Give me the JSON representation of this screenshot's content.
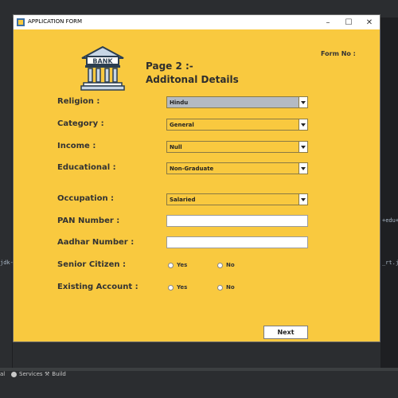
{
  "window": {
    "title": "APPLICATION FORM",
    "minimize_glyph": "–",
    "maximize_glyph": "☐",
    "close_glyph": "✕"
  },
  "header": {
    "bank_sign": "BANK",
    "page_title": "Page 2 :-",
    "page_subtitle": "Additonal Details",
    "form_no_label": "Form No :"
  },
  "fields": {
    "religion": {
      "label": "Religion :",
      "value": "Hindu"
    },
    "category": {
      "label": "Category :",
      "value": "General"
    },
    "income": {
      "label": "Income :",
      "value": "Null"
    },
    "educational": {
      "label": "Educational :",
      "value": "Non-Graduate"
    },
    "occupation": {
      "label": "Occupation :",
      "value": "Salaried"
    },
    "pan": {
      "label": "PAN Number :",
      "value": ""
    },
    "aadhar": {
      "label": "Aadhar Number :",
      "value": ""
    },
    "senior_citizen": {
      "label": "Senior Citizen :",
      "yes": "Yes",
      "no": "No"
    },
    "existing_account": {
      "label": "Existing Account :",
      "yes": "Yes",
      "no": "No"
    }
  },
  "buttons": {
    "next": "Next"
  },
  "ide": {
    "status_services": "Services",
    "status_build": "Build",
    "status_left": "al",
    "right_snippet_1": "+edu+",
    "right_snippet_2": "_rt.j",
    "left_snippet": "jdk-"
  },
  "colors": {
    "form_background": "#f9c93f",
    "selected_combo": "#b4bac2",
    "ide_background": "#2b2d30"
  }
}
